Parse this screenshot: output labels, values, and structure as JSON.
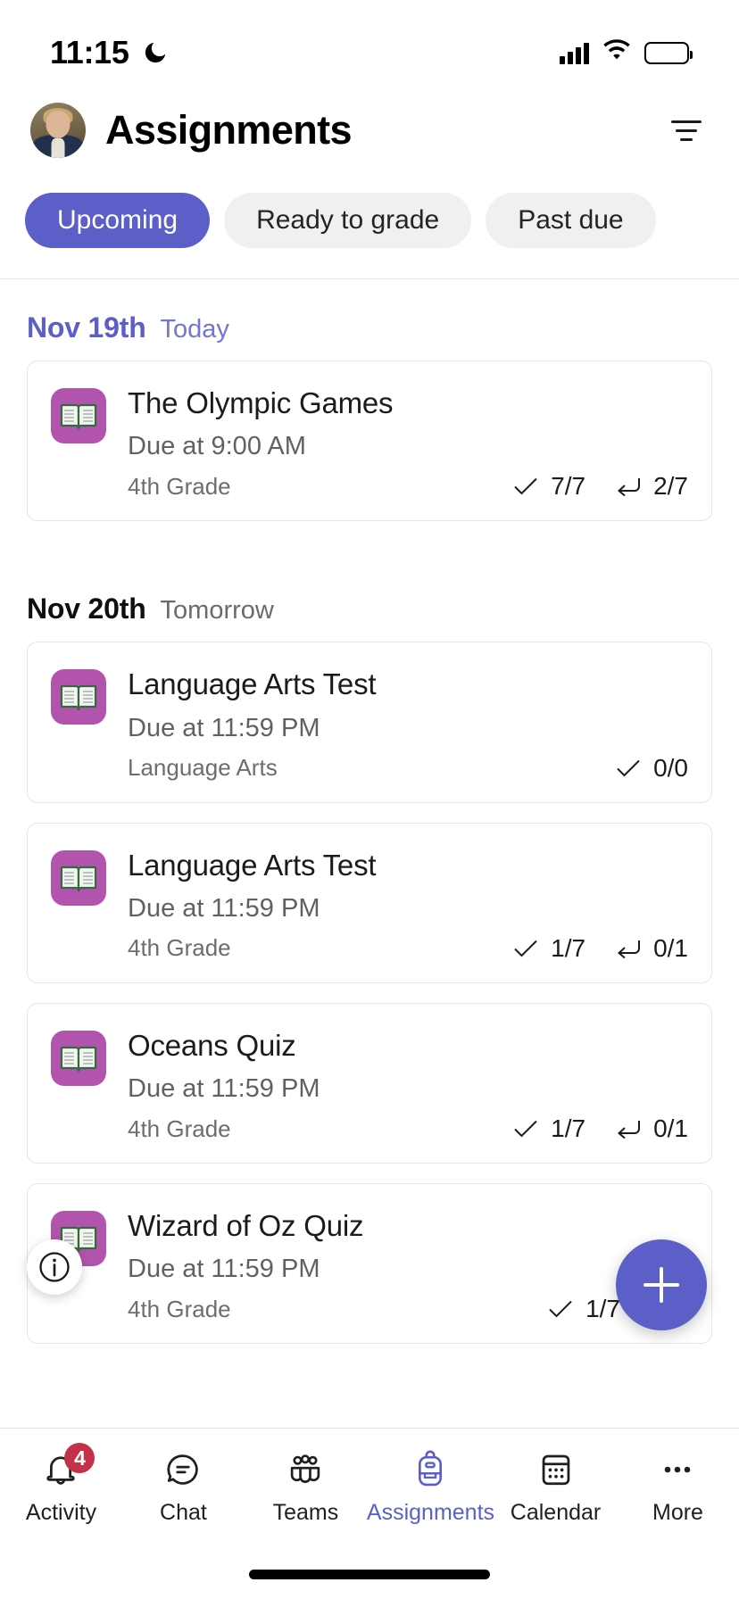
{
  "status_bar": {
    "time": "11:15",
    "dnd_icon": "moon-icon",
    "signal_icon": "cellular-signal-icon",
    "wifi_icon": "wifi-icon",
    "battery_icon": "battery-icon"
  },
  "header": {
    "title": "Assignments",
    "avatar_name": "user-avatar",
    "filter_icon": "filter-icon"
  },
  "filters": {
    "pills": [
      {
        "label": "Upcoming",
        "active": true
      },
      {
        "label": "Ready to grade",
        "active": false
      },
      {
        "label": "Past due",
        "active": false
      }
    ]
  },
  "groups": [
    {
      "date": "Nov 19th",
      "relative": "Today",
      "is_today": true,
      "assignments": [
        {
          "title": "The Olympic Games",
          "due": "Due at 9:00 AM",
          "class": "4th Grade",
          "icon": "open-book-icon",
          "stats": [
            {
              "icon": "checkmark-icon",
              "value": "7/7"
            },
            {
              "icon": "return-arrow-icon",
              "value": "2/7"
            }
          ]
        }
      ]
    },
    {
      "date": "Nov 20th",
      "relative": "Tomorrow",
      "is_today": false,
      "assignments": [
        {
          "title": "Language Arts Test",
          "due": "Due at 11:59 PM",
          "class": "Language Arts",
          "icon": "open-book-icon",
          "stats": [
            {
              "icon": "checkmark-icon",
              "value": "0/0"
            }
          ]
        },
        {
          "title": "Language Arts Test",
          "due": "Due at 11:59 PM",
          "class": "4th Grade",
          "icon": "open-book-icon",
          "stats": [
            {
              "icon": "checkmark-icon",
              "value": "1/7"
            },
            {
              "icon": "return-arrow-icon",
              "value": "0/1"
            }
          ]
        },
        {
          "title": "Oceans Quiz",
          "due": "Due at 11:59 PM",
          "class": "4th Grade",
          "icon": "open-book-icon",
          "stats": [
            {
              "icon": "checkmark-icon",
              "value": "1/7"
            },
            {
              "icon": "return-arrow-icon",
              "value": "0/1"
            }
          ]
        },
        {
          "title": "Wizard of Oz Quiz",
          "due": "Due at 11:59 PM",
          "class": "4th Grade",
          "icon": "open-book-icon",
          "stats": [
            {
              "icon": "checkmark-icon",
              "value": "1/7"
            },
            {
              "icon": "return-arrow-icon",
              "value": ""
            }
          ]
        }
      ]
    }
  ],
  "floating": {
    "info_icon": "info-circle-icon",
    "add_label": "+",
    "add_icon": "plus-icon"
  },
  "bottom_nav": {
    "items": [
      {
        "label": "Activity",
        "icon": "bell-icon",
        "badge": "4",
        "active": false
      },
      {
        "label": "Chat",
        "icon": "chat-bubble-icon",
        "badge": null,
        "active": false
      },
      {
        "label": "Teams",
        "icon": "teams-people-icon",
        "badge": null,
        "active": false
      },
      {
        "label": "Assignments",
        "icon": "backpack-icon",
        "badge": null,
        "active": true
      },
      {
        "label": "Calendar",
        "icon": "calendar-icon",
        "badge": null,
        "active": false
      },
      {
        "label": "More",
        "icon": "ellipsis-icon",
        "badge": null,
        "active": false
      }
    ]
  },
  "colors": {
    "accent": "#5b5fc7",
    "badge": "#c4314b",
    "assignment_icon_bg": "#b254ad",
    "pill_inactive_bg": "#f0f0f0"
  }
}
